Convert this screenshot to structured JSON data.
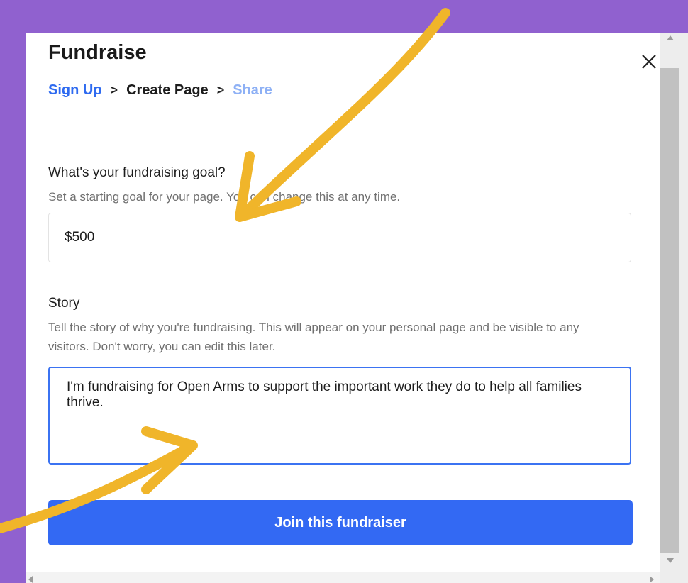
{
  "modal": {
    "title": "Fundraise",
    "close_icon": "close-icon"
  },
  "breadcrumb": {
    "steps": [
      "Sign Up",
      "Create Page",
      "Share"
    ],
    "separator": ">"
  },
  "goal": {
    "label": "What's your fundraising goal?",
    "help": "Set a starting goal for your page. You can change this at any time.",
    "value": "$500"
  },
  "story": {
    "label": "Story",
    "help": "Tell the story of why you're fundraising. This will appear on your personal page and be visible to any visitors. Don't worry, you can edit this later.",
    "value": "I'm fundraising for Open Arms to support the important work they do to help all families thrive."
  },
  "actions": {
    "join_label": "Join this fundraiser"
  },
  "colors": {
    "background": "#9061cf",
    "accent": "#3369f3",
    "annotation_arrow": "#f0b52a"
  }
}
